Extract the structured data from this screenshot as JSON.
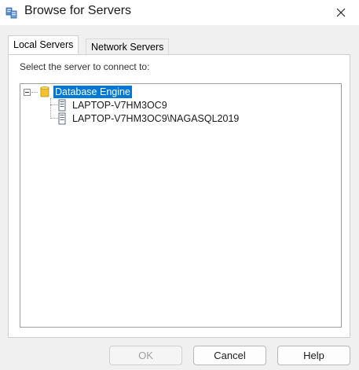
{
  "window": {
    "title": "Browse for Servers",
    "title_icon": "servers-icon",
    "close_icon": "close-icon"
  },
  "tabs": [
    {
      "label": "Local Servers",
      "selected": true
    },
    {
      "label": "Network Servers",
      "selected": false
    }
  ],
  "panel": {
    "prompt": "Select the server to connect to:"
  },
  "tree": {
    "root": {
      "label": "Database Engine",
      "icon": "database-engine-icon",
      "expanded": true,
      "selected": true
    },
    "children": [
      {
        "label": "LAPTOP-V7HM3OC9",
        "icon": "server-icon"
      },
      {
        "label": "LAPTOP-V7HM3OC9\\NAGASQL2019",
        "icon": "server-icon"
      }
    ]
  },
  "buttons": {
    "ok": "OK",
    "cancel": "Cancel",
    "help": "Help"
  },
  "colors": {
    "selection": "#0078d7"
  }
}
